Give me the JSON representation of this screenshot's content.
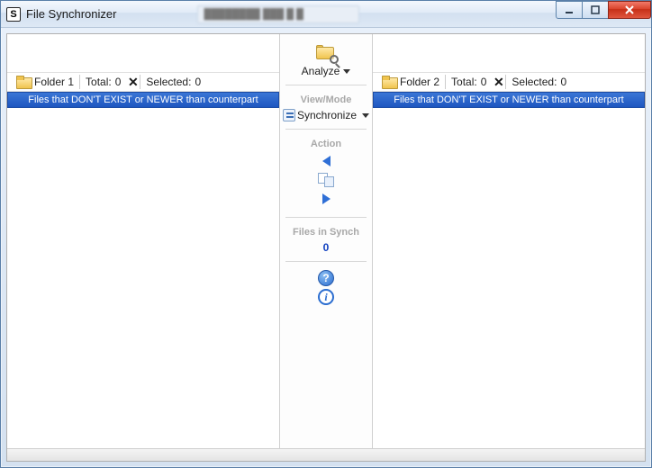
{
  "window": {
    "title": "File Synchronizer",
    "app_icon_glyph": "S",
    "background_tab_text": "████████  ███ █ █"
  },
  "left": {
    "folder_label": "Folder 1",
    "total_label": "Total:",
    "total_value": "0",
    "selected_label": "Selected:",
    "selected_value": "0",
    "banner": "Files that DON'T EXIST or NEWER than counterpart"
  },
  "right": {
    "folder_label": "Folder 2",
    "total_label": "Total:",
    "total_value": "0",
    "selected_label": "Selected:",
    "selected_value": "0",
    "banner": "Files that DON'T EXIST or NEWER than counterpart"
  },
  "center": {
    "analyze_label": "Analyze",
    "viewmode_heading": "View/Mode",
    "viewmode_value": "Synchronize",
    "action_heading": "Action",
    "files_in_synch_heading": "Files in Synch",
    "files_in_synch_count": "0",
    "help_glyph": "?",
    "info_glyph": "i"
  },
  "colors": {
    "banner_bg_start": "#3b76d6",
    "banner_bg_end": "#1d56c0",
    "accent_blue": "#2f6fd6"
  }
}
